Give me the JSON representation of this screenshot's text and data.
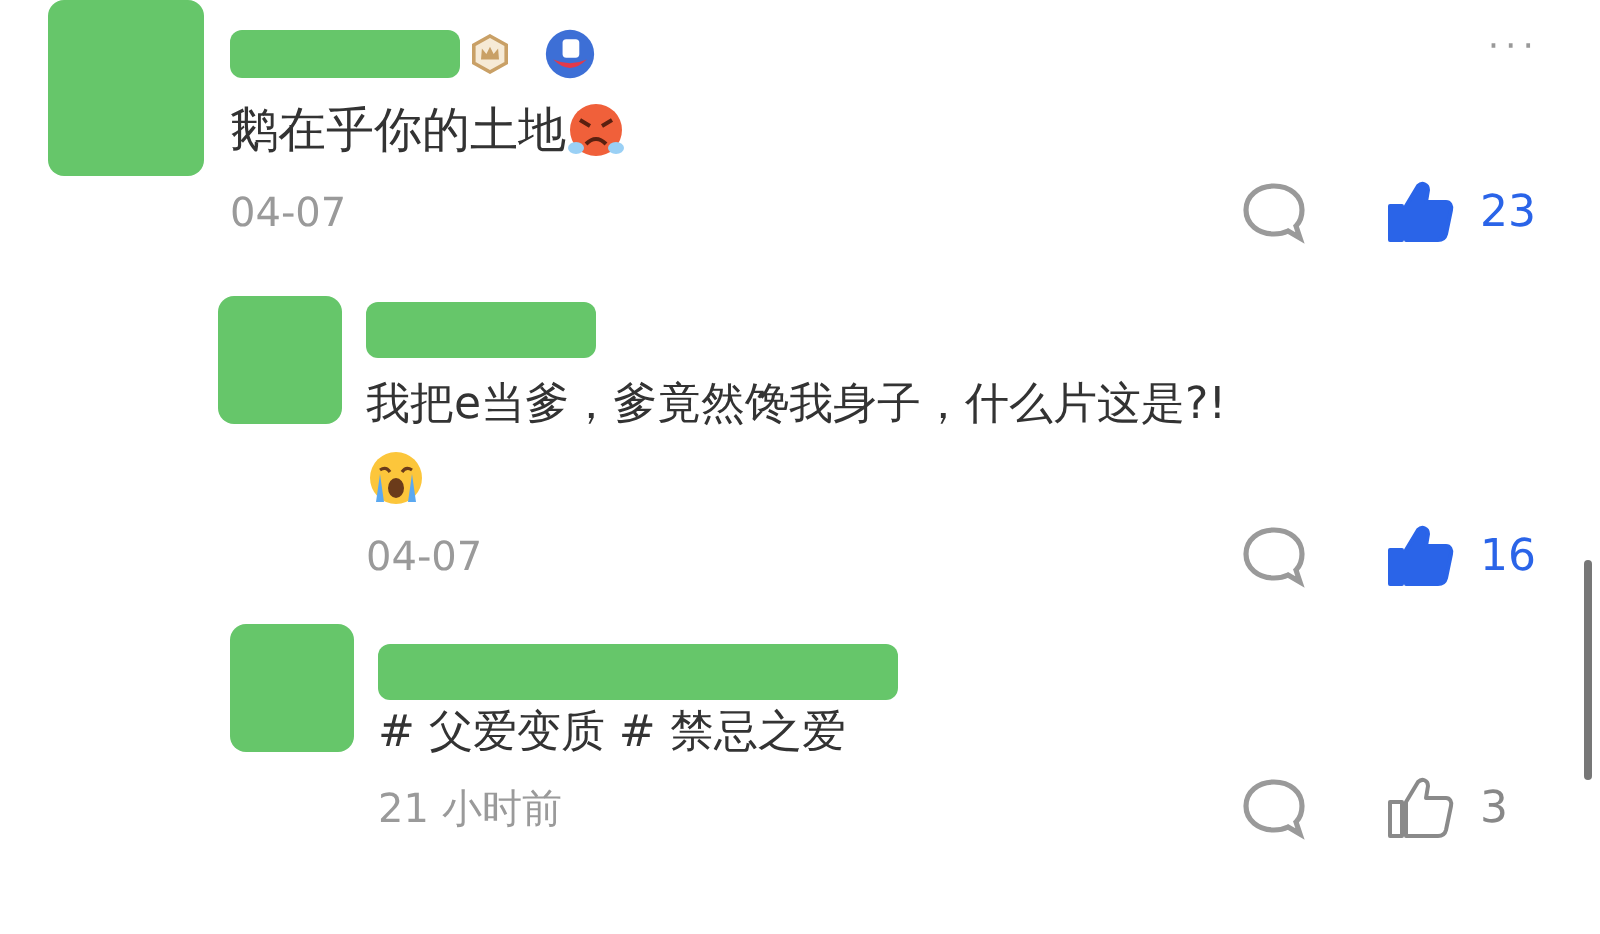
{
  "comments": [
    {
      "text": "鹅在乎你的土地",
      "emoji": {
        "kind": "angry"
      },
      "badges": [
        {
          "kind": "crown"
        },
        {
          "kind": "mascot"
        }
      ],
      "more": "···",
      "date": "04-07",
      "like_count": "23",
      "liked": true,
      "replies": [
        {
          "text": "我把e当爹，爹竟然馋我身子，什么片这是?!",
          "emoji": {
            "kind": "crying"
          },
          "date": "04-07",
          "like_count": "16",
          "liked": true
        },
        {
          "text": "# 父爱变质 # 禁忌之爱",
          "date": "21 小时前",
          "like_count": "3",
          "liked": false
        }
      ]
    }
  ]
}
